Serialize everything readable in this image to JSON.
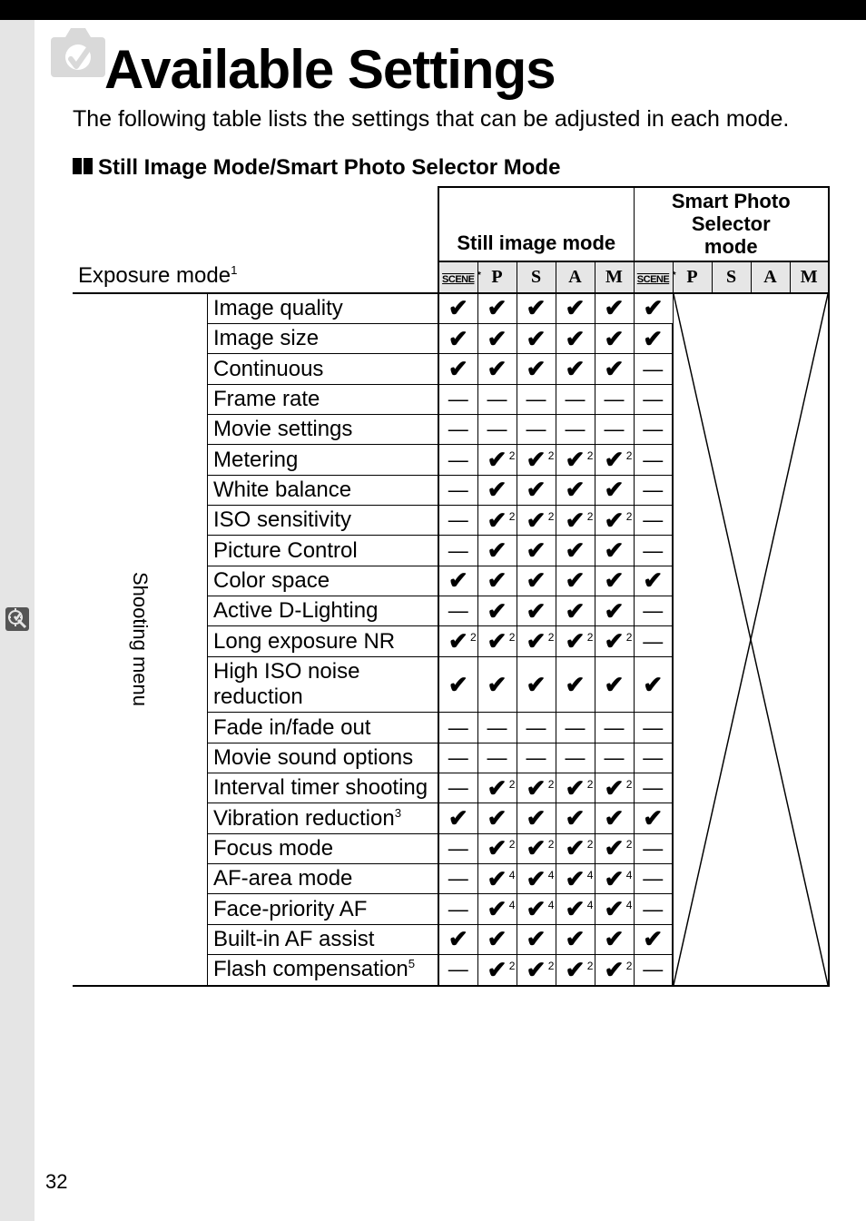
{
  "page_number": "32",
  "title": "Available Settings",
  "intro": "The following table lists the settings that can be adjusted in each mode.",
  "subheading": "Still Image Mode/Smart Photo Selector Mode",
  "group_labels": {
    "still": "Still image mode",
    "smart_line1": "Smart Photo Selector",
    "smart_line2": "mode"
  },
  "exposure_row_label": "Exposure mode",
  "exposure_row_sup": "1",
  "column_headers": [
    "SCENE",
    "P",
    "S",
    "A",
    "M",
    "SCENE",
    "P",
    "S",
    "A",
    "M"
  ],
  "row_group_label": "Shooting menu",
  "rows": [
    {
      "name": "Image quality",
      "cells": [
        "✔",
        "✔",
        "✔",
        "✔",
        "✔",
        "✔"
      ]
    },
    {
      "name": "Image size",
      "cells": [
        "✔",
        "✔",
        "✔",
        "✔",
        "✔",
        "✔"
      ]
    },
    {
      "name": "Continuous",
      "cells": [
        "✔",
        "✔",
        "✔",
        "✔",
        "✔",
        "—"
      ]
    },
    {
      "name": "Frame rate",
      "cells": [
        "—",
        "—",
        "—",
        "—",
        "—",
        "—"
      ]
    },
    {
      "name": "Movie settings",
      "cells": [
        "—",
        "—",
        "—",
        "—",
        "—",
        "—"
      ]
    },
    {
      "name": "Metering",
      "cells": [
        "—",
        "✔2",
        "✔2",
        "✔2",
        "✔2",
        "—"
      ]
    },
    {
      "name": "White balance",
      "cells": [
        "—",
        "✔",
        "✔",
        "✔",
        "✔",
        "—"
      ]
    },
    {
      "name": "ISO sensitivity",
      "cells": [
        "—",
        "✔2",
        "✔2",
        "✔2",
        "✔2",
        "—"
      ]
    },
    {
      "name": "Picture Control",
      "cells": [
        "—",
        "✔",
        "✔",
        "✔",
        "✔",
        "—"
      ]
    },
    {
      "name": "Color space",
      "cells": [
        "✔",
        "✔",
        "✔",
        "✔",
        "✔",
        "✔"
      ]
    },
    {
      "name": "Active D-Lighting",
      "cells": [
        "—",
        "✔",
        "✔",
        "✔",
        "✔",
        "—"
      ]
    },
    {
      "name": "Long exposure NR",
      "cells": [
        "✔2",
        "✔2",
        "✔2",
        "✔2",
        "✔2",
        "—"
      ]
    },
    {
      "name": "High ISO noise reduction",
      "cells": [
        "✔",
        "✔",
        "✔",
        "✔",
        "✔",
        "✔"
      ]
    },
    {
      "name": "Fade in/fade out",
      "cells": [
        "—",
        "—",
        "—",
        "—",
        "—",
        "—"
      ]
    },
    {
      "name": "Movie sound options",
      "cells": [
        "—",
        "—",
        "—",
        "—",
        "—",
        "—"
      ]
    },
    {
      "name": "Interval timer shooting",
      "cells": [
        "—",
        "✔2",
        "✔2",
        "✔2",
        "✔2",
        "—"
      ]
    },
    {
      "name": "Vibration reduction",
      "sup": "3",
      "cells": [
        "✔",
        "✔",
        "✔",
        "✔",
        "✔",
        "✔"
      ]
    },
    {
      "name": "Focus mode",
      "cells": [
        "—",
        "✔2",
        "✔2",
        "✔2",
        "✔2",
        "—"
      ]
    },
    {
      "name": "AF-area mode",
      "cells": [
        "—",
        "✔4",
        "✔4",
        "✔4",
        "✔4",
        "—"
      ]
    },
    {
      "name": "Face-priority AF",
      "cells": [
        "—",
        "✔4",
        "✔4",
        "✔4",
        "✔4",
        "—"
      ]
    },
    {
      "name": "Built-in AF assist",
      "cells": [
        "✔",
        "✔",
        "✔",
        "✔",
        "✔",
        "✔"
      ]
    },
    {
      "name": "Flash compensation",
      "sup": "5",
      "cells": [
        "—",
        "✔2",
        "✔2",
        "✔2",
        "✔2",
        "—"
      ]
    }
  ]
}
